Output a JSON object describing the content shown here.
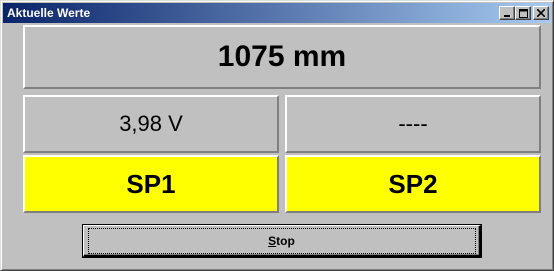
{
  "window": {
    "title": "Aktuelle Werte",
    "buttons": [
      "minimize-icon",
      "maximize-icon",
      "close-icon"
    ]
  },
  "values": {
    "distance": "1075 mm",
    "voltage": "3,98 V",
    "second": "----"
  },
  "setpoints": {
    "sp1": "SP1",
    "sp2": "SP2",
    "active_color": "#ffff00"
  },
  "actions": {
    "stop_first": "S",
    "stop_rest": "top"
  }
}
